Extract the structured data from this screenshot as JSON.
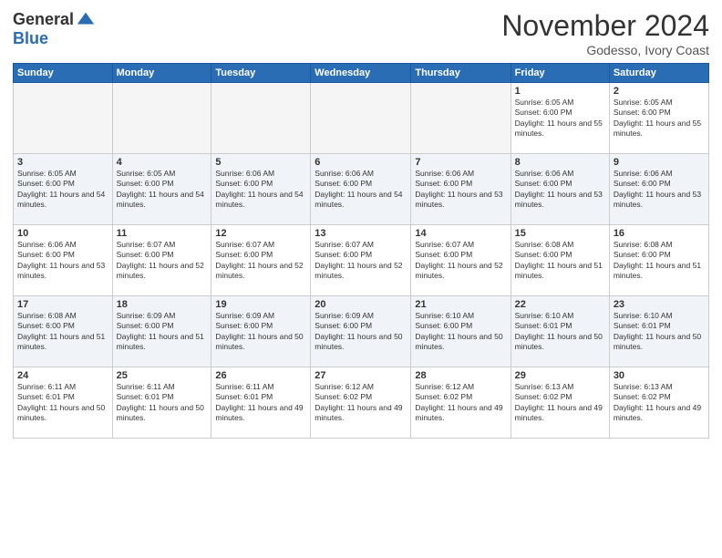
{
  "logo": {
    "general": "General",
    "blue": "Blue"
  },
  "header": {
    "month": "November 2024",
    "location": "Godesso, Ivory Coast"
  },
  "weekdays": [
    "Sunday",
    "Monday",
    "Tuesday",
    "Wednesday",
    "Thursday",
    "Friday",
    "Saturday"
  ],
  "weeks": [
    [
      {
        "day": "",
        "empty": true
      },
      {
        "day": "",
        "empty": true
      },
      {
        "day": "",
        "empty": true
      },
      {
        "day": "",
        "empty": true
      },
      {
        "day": "",
        "empty": true
      },
      {
        "day": "1",
        "sunrise": "6:05 AM",
        "sunset": "6:00 PM",
        "daylight": "11 hours and 55 minutes."
      },
      {
        "day": "2",
        "sunrise": "6:05 AM",
        "sunset": "6:00 PM",
        "daylight": "11 hours and 55 minutes."
      }
    ],
    [
      {
        "day": "3",
        "sunrise": "6:05 AM",
        "sunset": "6:00 PM",
        "daylight": "11 hours and 54 minutes."
      },
      {
        "day": "4",
        "sunrise": "6:05 AM",
        "sunset": "6:00 PM",
        "daylight": "11 hours and 54 minutes."
      },
      {
        "day": "5",
        "sunrise": "6:06 AM",
        "sunset": "6:00 PM",
        "daylight": "11 hours and 54 minutes."
      },
      {
        "day": "6",
        "sunrise": "6:06 AM",
        "sunset": "6:00 PM",
        "daylight": "11 hours and 54 minutes."
      },
      {
        "day": "7",
        "sunrise": "6:06 AM",
        "sunset": "6:00 PM",
        "daylight": "11 hours and 53 minutes."
      },
      {
        "day": "8",
        "sunrise": "6:06 AM",
        "sunset": "6:00 PM",
        "daylight": "11 hours and 53 minutes."
      },
      {
        "day": "9",
        "sunrise": "6:06 AM",
        "sunset": "6:00 PM",
        "daylight": "11 hours and 53 minutes."
      }
    ],
    [
      {
        "day": "10",
        "sunrise": "6:06 AM",
        "sunset": "6:00 PM",
        "daylight": "11 hours and 53 minutes."
      },
      {
        "day": "11",
        "sunrise": "6:07 AM",
        "sunset": "6:00 PM",
        "daylight": "11 hours and 52 minutes."
      },
      {
        "day": "12",
        "sunrise": "6:07 AM",
        "sunset": "6:00 PM",
        "daylight": "11 hours and 52 minutes."
      },
      {
        "day": "13",
        "sunrise": "6:07 AM",
        "sunset": "6:00 PM",
        "daylight": "11 hours and 52 minutes."
      },
      {
        "day": "14",
        "sunrise": "6:07 AM",
        "sunset": "6:00 PM",
        "daylight": "11 hours and 52 minutes."
      },
      {
        "day": "15",
        "sunrise": "6:08 AM",
        "sunset": "6:00 PM",
        "daylight": "11 hours and 51 minutes."
      },
      {
        "day": "16",
        "sunrise": "6:08 AM",
        "sunset": "6:00 PM",
        "daylight": "11 hours and 51 minutes."
      }
    ],
    [
      {
        "day": "17",
        "sunrise": "6:08 AM",
        "sunset": "6:00 PM",
        "daylight": "11 hours and 51 minutes."
      },
      {
        "day": "18",
        "sunrise": "6:09 AM",
        "sunset": "6:00 PM",
        "daylight": "11 hours and 51 minutes."
      },
      {
        "day": "19",
        "sunrise": "6:09 AM",
        "sunset": "6:00 PM",
        "daylight": "11 hours and 50 minutes."
      },
      {
        "day": "20",
        "sunrise": "6:09 AM",
        "sunset": "6:00 PM",
        "daylight": "11 hours and 50 minutes."
      },
      {
        "day": "21",
        "sunrise": "6:10 AM",
        "sunset": "6:00 PM",
        "daylight": "11 hours and 50 minutes."
      },
      {
        "day": "22",
        "sunrise": "6:10 AM",
        "sunset": "6:01 PM",
        "daylight": "11 hours and 50 minutes."
      },
      {
        "day": "23",
        "sunrise": "6:10 AM",
        "sunset": "6:01 PM",
        "daylight": "11 hours and 50 minutes."
      }
    ],
    [
      {
        "day": "24",
        "sunrise": "6:11 AM",
        "sunset": "6:01 PM",
        "daylight": "11 hours and 50 minutes."
      },
      {
        "day": "25",
        "sunrise": "6:11 AM",
        "sunset": "6:01 PM",
        "daylight": "11 hours and 50 minutes."
      },
      {
        "day": "26",
        "sunrise": "6:11 AM",
        "sunset": "6:01 PM",
        "daylight": "11 hours and 49 minutes."
      },
      {
        "day": "27",
        "sunrise": "6:12 AM",
        "sunset": "6:02 PM",
        "daylight": "11 hours and 49 minutes."
      },
      {
        "day": "28",
        "sunrise": "6:12 AM",
        "sunset": "6:02 PM",
        "daylight": "11 hours and 49 minutes."
      },
      {
        "day": "29",
        "sunrise": "6:13 AM",
        "sunset": "6:02 PM",
        "daylight": "11 hours and 49 minutes."
      },
      {
        "day": "30",
        "sunrise": "6:13 AM",
        "sunset": "6:02 PM",
        "daylight": "11 hours and 49 minutes."
      }
    ]
  ]
}
